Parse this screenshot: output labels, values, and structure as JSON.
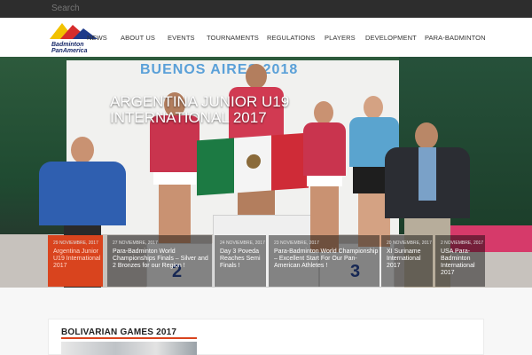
{
  "search": {
    "placeholder": "Search"
  },
  "logo": {
    "line1": "Badminton",
    "line2": "PanAmerica"
  },
  "nav": {
    "items": [
      "NEWS",
      "ABOUT US",
      "EVENTS",
      "TOURNAMENTS",
      "REGULATIONS",
      "PLAYERS",
      "DEVELOPMENT",
      "PARA-BADMINTON"
    ]
  },
  "hero": {
    "title": "ARGENTINA JUNIOR U19 INTERNATIONAL 2017",
    "banner_text": "BUENOS AIRES 2018"
  },
  "news": [
    {
      "date": "29 NOVIEMBRE, 2017",
      "title": "Argentina Junior U19 International 2017"
    },
    {
      "date": "27 NOVIEMBRE, 2017",
      "title": "Para-Badminton World Championships Finals – Silver and 2 Bronzes for our Region !"
    },
    {
      "date": "24 NOVIEMBRE, 2017",
      "title": "Day 3 Poveda Reaches Semi Finals !"
    },
    {
      "date": "23 NOVIEMBRE, 2017",
      "title": "Para-Badminton World Championship – Excellent Start For Our Pan-American Athletes !"
    },
    {
      "date": "20 NOVIEMBRE, 2017",
      "title": "XI Suriname International 2017"
    },
    {
      "date": "2 NOVIEMBRE, 2017",
      "title": "USA Para-Badminton International 2017"
    }
  ],
  "section": {
    "title": "BOLIVARIAN GAMES 2017"
  },
  "colors": {
    "accent": "#d9441e",
    "topbar": "#2d2d2d"
  }
}
